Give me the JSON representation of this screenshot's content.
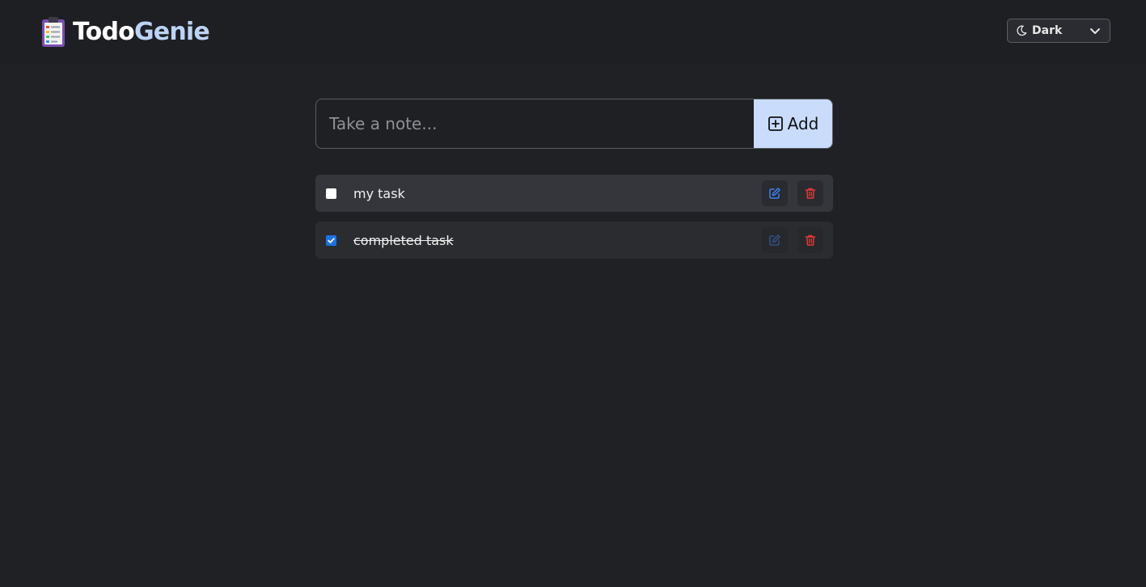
{
  "app": {
    "name_part1": "Todo",
    "name_part2": "Genie",
    "logo_icon": "clipboard-icon"
  },
  "theme": {
    "selected": "Dark",
    "icon": "moon-icon"
  },
  "note": {
    "placeholder": "Take a note...",
    "value": "",
    "add_label": "Add",
    "add_icon": "plus-square-icon"
  },
  "tasks": [
    {
      "text": "my task",
      "completed": false
    },
    {
      "text": "completed task",
      "completed": true
    }
  ],
  "colors": {
    "accent": "#c9dcfb",
    "brand_accent": "#bcd3f5",
    "edit": "#3b82f6",
    "delete": "#e53935",
    "background": "#202125"
  }
}
